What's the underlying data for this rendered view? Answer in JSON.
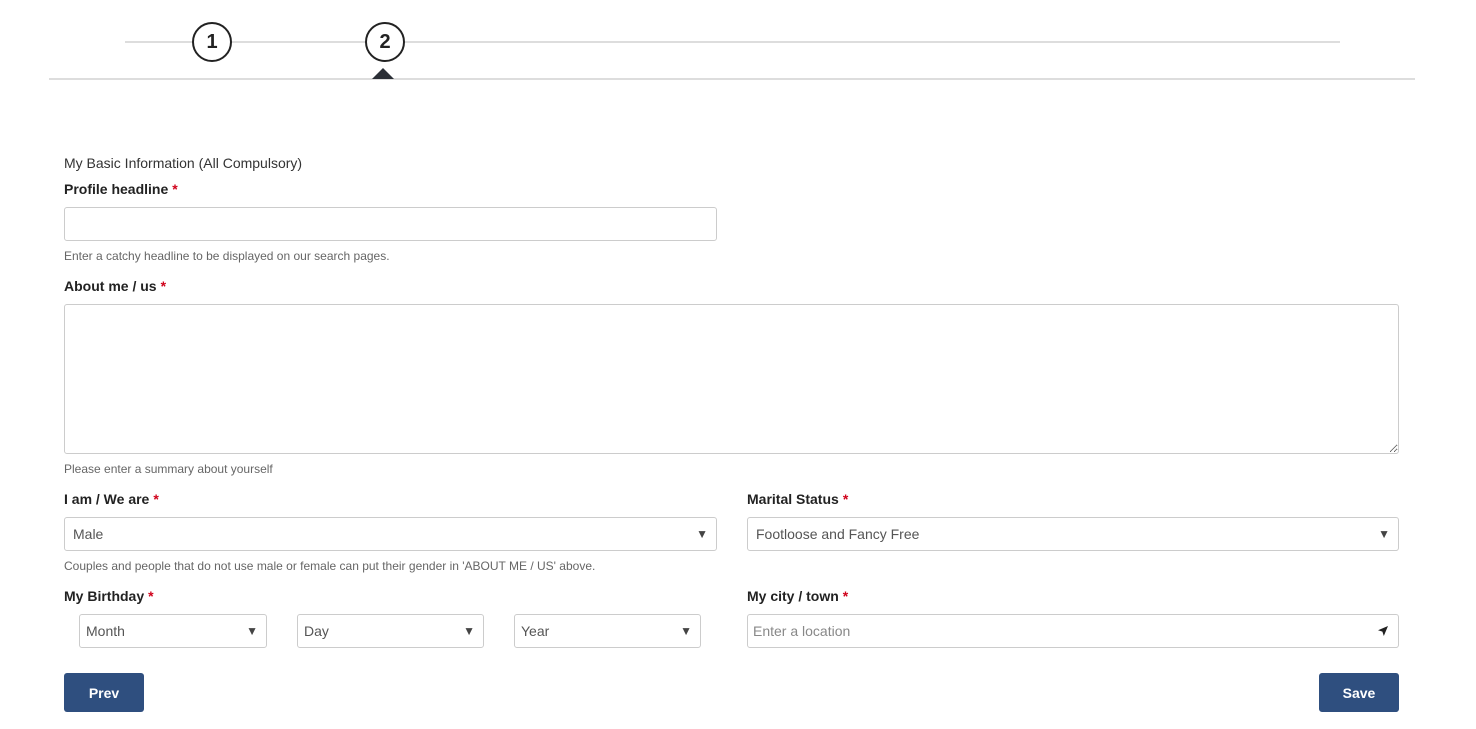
{
  "stepper": {
    "steps": [
      {
        "label": "1"
      },
      {
        "label": "2"
      }
    ]
  },
  "form": {
    "section_title": "My Basic Information (All Compulsory)",
    "required_mark": "*",
    "headline": {
      "label": "Profile headline",
      "value": "",
      "help": "Enter a catchy headline to be displayed on our search pages."
    },
    "about": {
      "label": "About me / us",
      "value": "",
      "help": "Please enter a summary about yourself"
    },
    "gender": {
      "label": "I am / We are",
      "selected": "Male",
      "help": "Couples and people that do not use male or female can put their gender in 'ABOUT ME / US' above."
    },
    "marital": {
      "label": "Marital Status",
      "selected": "Footloose and Fancy Free"
    },
    "birthday": {
      "label": "My Birthday",
      "month": "Month",
      "day": "Day",
      "year": "Year"
    },
    "city": {
      "label": "My city / town",
      "placeholder": "Enter a location"
    }
  },
  "actions": {
    "prev_label": "Prev",
    "save_label": "Save"
  },
  "colors": {
    "button_bg": "#2f4f7f",
    "required": "#d0021b"
  },
  "icons": {
    "dropdown": "chevron-down-icon",
    "location": "location-arrow-icon"
  }
}
